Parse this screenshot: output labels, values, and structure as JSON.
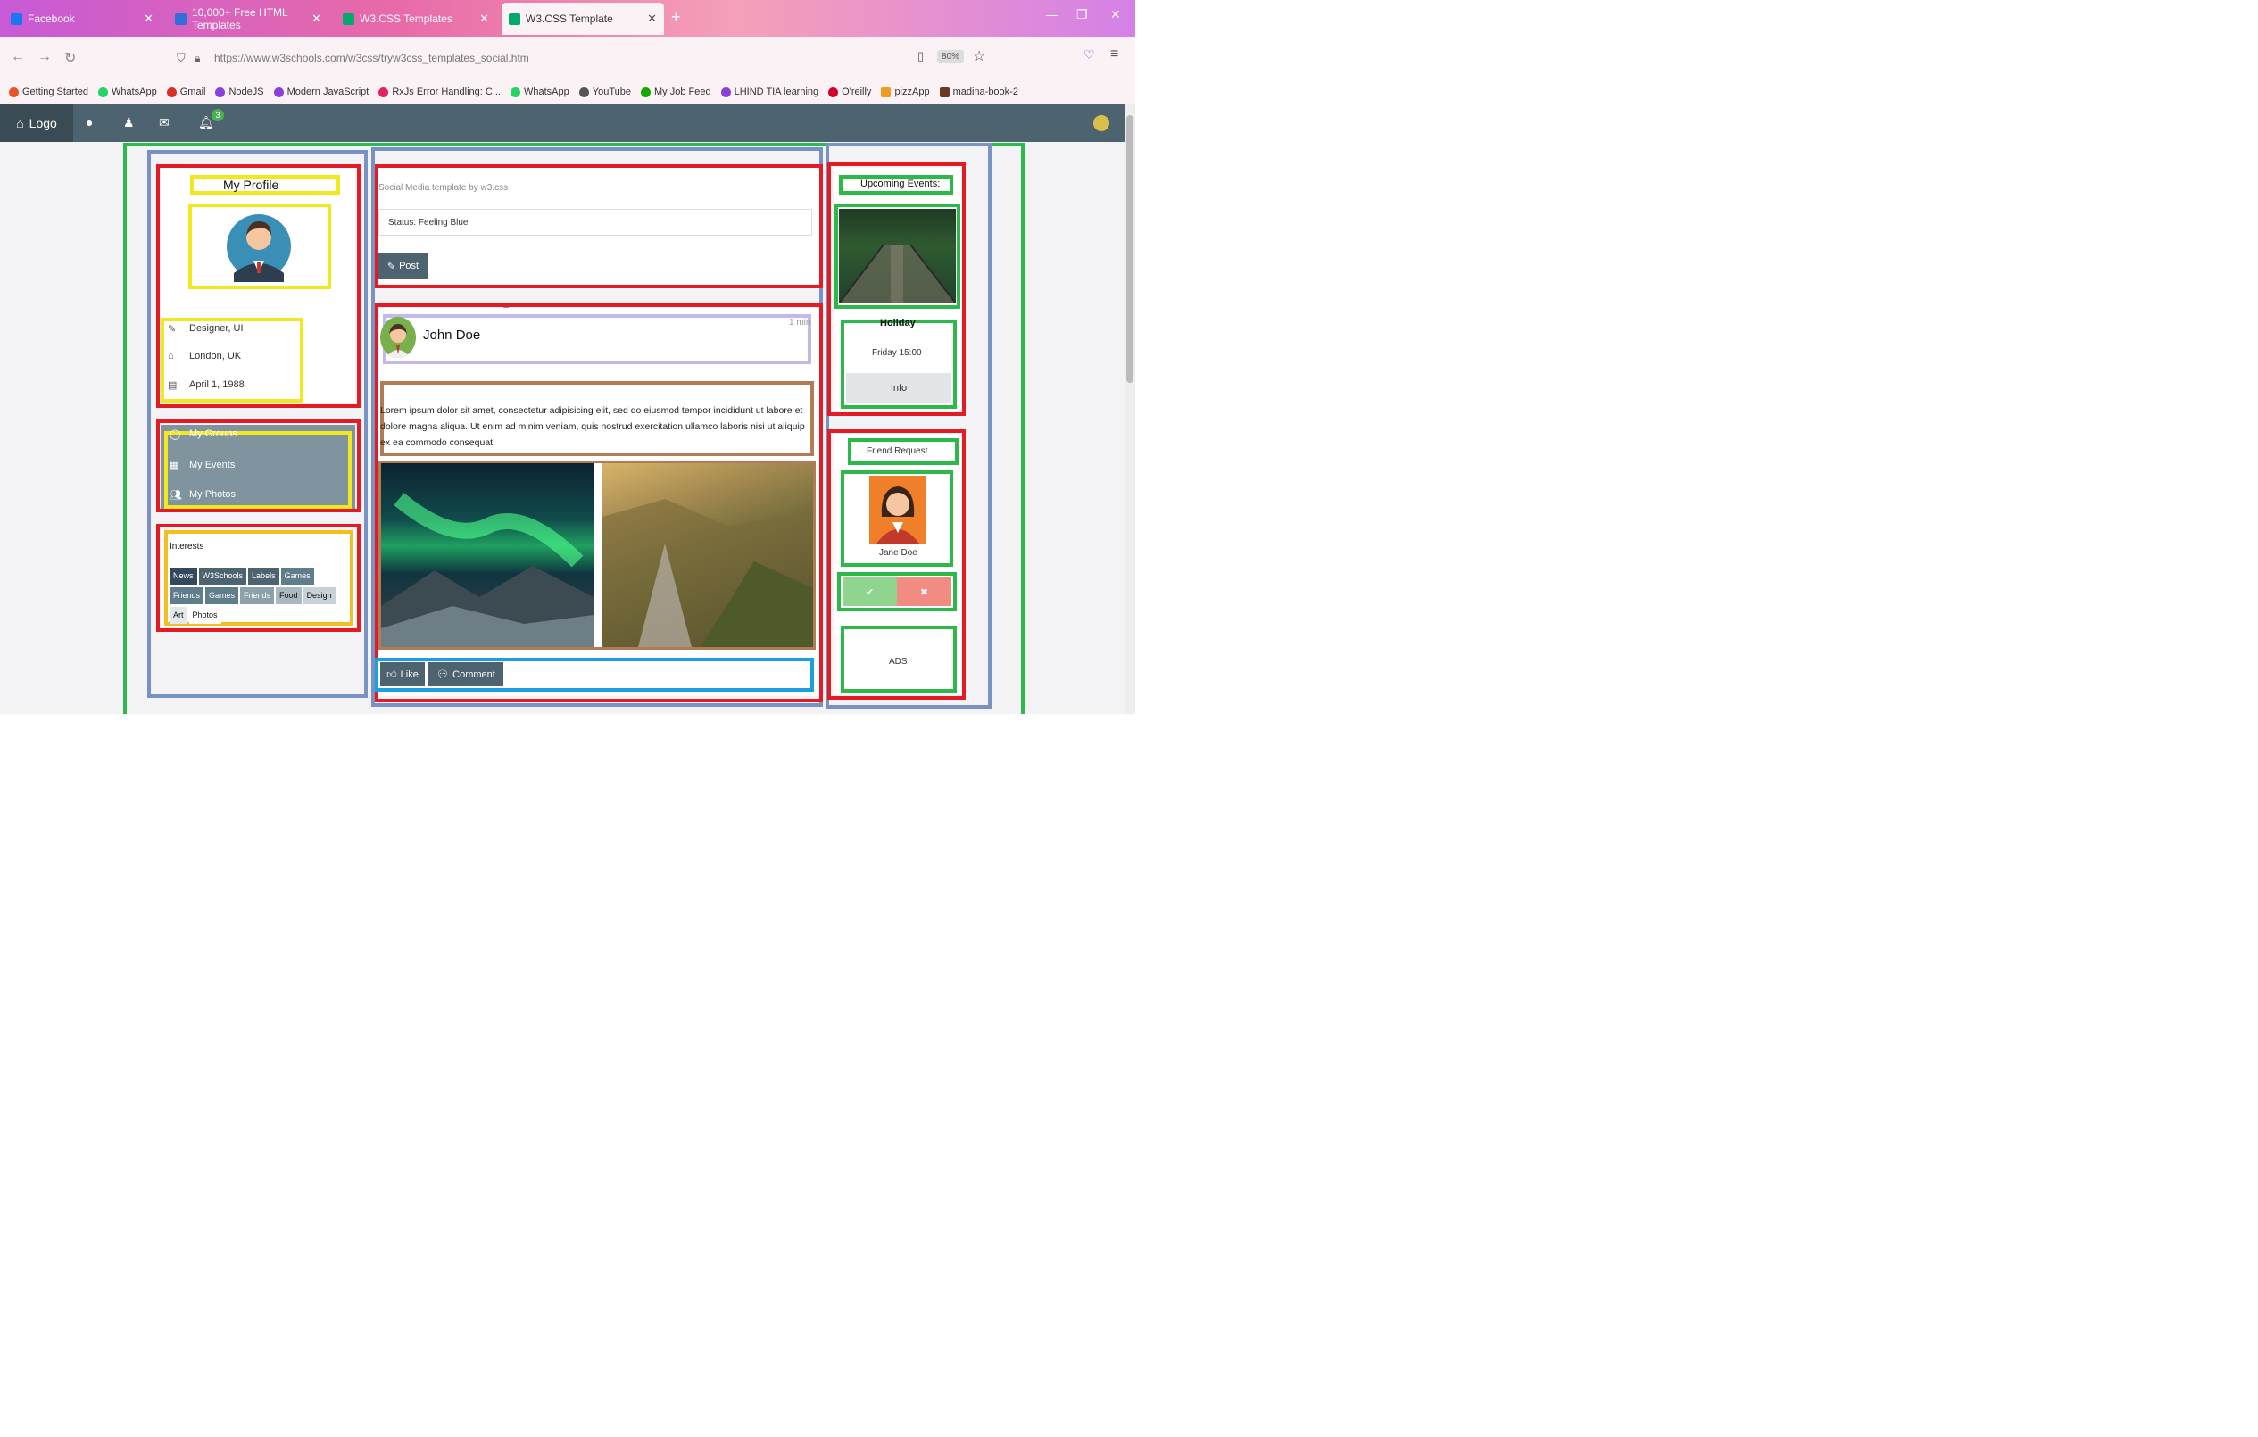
{
  "browser": {
    "tabs": [
      {
        "label": "Facebook",
        "favicon_color": "#1877f2"
      },
      {
        "label": "10,000+ Free HTML Templates",
        "favicon_color": "#2f6fd6"
      },
      {
        "label": "W3.CSS Templates",
        "favicon_color": "#04aa6d"
      },
      {
        "label": "W3.CSS Template",
        "favicon_color": "#04aa6d"
      }
    ],
    "new_tab": "+",
    "url": "https://www.w3schools.com/w3css/tryw3css_templates_social.htm",
    "zoom": "80%",
    "bookmarks": [
      {
        "label": "Getting Started",
        "color": "#e8552a"
      },
      {
        "label": "WhatsApp",
        "color": "#25d366"
      },
      {
        "label": "Gmail",
        "color": "#d93025"
      },
      {
        "label": "NodeJS",
        "color": "#8b3fd9"
      },
      {
        "label": "Modern JavaScript",
        "color": "#8b3fd9"
      },
      {
        "label": "RxJs Error Handling: C...",
        "color": "#e0245e"
      },
      {
        "label": "WhatsApp",
        "color": "#25d366"
      },
      {
        "label": "YouTube",
        "color": "#555"
      },
      {
        "label": "My Job Feed",
        "color": "#14a800"
      },
      {
        "label": "LHIND TIA learning",
        "color": "#8b3fd9"
      },
      {
        "label": "O'reilly",
        "color": "#d3002d"
      },
      {
        "label": "pizzApp",
        "color": "#f29c1f"
      },
      {
        "label": "madina-book-2",
        "color": "#6b3a1e"
      }
    ]
  },
  "w3nav": {
    "logo": "Logo",
    "badge": "3"
  },
  "profile": {
    "title": "My Profile",
    "job": "Designer, UI",
    "city": "London, UK",
    "birthday": "April 1, 1988"
  },
  "accordion": {
    "groups": "My Groups",
    "events": "My Events",
    "photos": "My Photos"
  },
  "interests": {
    "title": "Interests",
    "tags": [
      {
        "label": "News",
        "color": "#34495e"
      },
      {
        "label": "W3Schools",
        "color": "#4d636f"
      },
      {
        "label": "Labels",
        "color": "#4d636f"
      },
      {
        "label": "Games",
        "color": "#607d8b"
      },
      {
        "label": "Friends",
        "color": "#607d8b"
      },
      {
        "label": "Games",
        "color": "#607d8b"
      },
      {
        "label": "Friends",
        "color": "#8da0ab"
      },
      {
        "label": "Food",
        "color": "#a9b8c1"
      },
      {
        "label": "Design",
        "color": "#c7d1d7"
      },
      {
        "label": "Art",
        "color": "#e3e8eb"
      },
      {
        "label": "Photos",
        "color": "#ffffff"
      }
    ]
  },
  "composer": {
    "caption": "Social Media template by w3.css",
    "status": "Status: Feeling Blue",
    "post_button": "Post"
  },
  "post": {
    "author": "John Doe",
    "time": "1 min",
    "body": "Lorem ipsum dolor sit amet, consectetur adipisicing elit, sed do eiusmod tempor incididunt ut labore et dolore magna aliqua. Ut enim ad minim veniam, quis nostrud exercitation ullamco laboris nisi ut aliquip ex ea commodo consequat.",
    "like": "Like",
    "comment": "Comment"
  },
  "events": {
    "title": "Upcoming Events:",
    "name": "Holiday",
    "when": "Friday 15:00",
    "info": "Info"
  },
  "friend": {
    "title": "Friend Request",
    "name": "Jane Doe",
    "accept": "✔",
    "decline": "✖"
  },
  "ads": {
    "label": "ADS"
  }
}
